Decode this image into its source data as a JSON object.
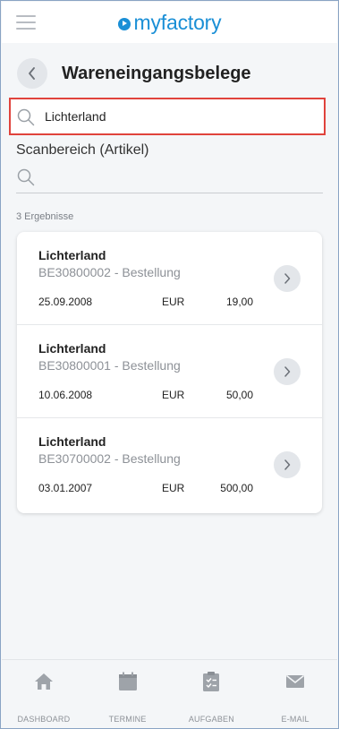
{
  "app": {
    "brand": "myfactory"
  },
  "header": {
    "title": "Wareneingangsbelege"
  },
  "search": {
    "value": "Lichterland"
  },
  "scan": {
    "label": "Scanbereich (Artikel)"
  },
  "results": {
    "count_label": "3 Ergebnisse",
    "items": [
      {
        "name": "Lichterland",
        "doc": "BE30800002 - Bestellung",
        "date": "25.09.2008",
        "currency": "EUR",
        "amount": "19,00"
      },
      {
        "name": "Lichterland",
        "doc": "BE30800001 - Bestellung",
        "date": "10.06.2008",
        "currency": "EUR",
        "amount": "50,00"
      },
      {
        "name": "Lichterland",
        "doc": "BE30700002 - Bestellung",
        "date": "03.01.2007",
        "currency": "EUR",
        "amount": "500,00"
      }
    ]
  },
  "nav": {
    "items": [
      {
        "label": "DASHBOARD",
        "icon": "home-icon"
      },
      {
        "label": "TERMINE",
        "icon": "calendar-icon"
      },
      {
        "label": "AUFGABEN",
        "icon": "clipboard-check-icon"
      },
      {
        "label": "E-MAIL",
        "icon": "mail-icon"
      }
    ]
  },
  "colors": {
    "brand": "#1a8fd6",
    "highlight_border": "#e0433c",
    "background": "#f4f6f8"
  }
}
